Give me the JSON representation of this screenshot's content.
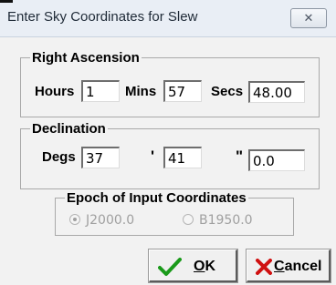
{
  "window": {
    "title": "Enter Sky Coordinates for Slew",
    "close_glyph": "✕"
  },
  "right_ascension": {
    "legend": "Right Ascension",
    "hours_label": "Hours",
    "hours_value": "1",
    "mins_label": "Mins",
    "mins_value": "57",
    "secs_label": "Secs",
    "secs_value": "48.00"
  },
  "declination": {
    "legend": "Declination",
    "degs_label": "Degs",
    "degs_value": "37",
    "min_symbol": "'",
    "min_value": "41",
    "sec_symbol": "\"",
    "sec_value": "0.0"
  },
  "epoch": {
    "legend": "Epoch of Input Coordinates",
    "options": [
      {
        "label": "J2000.0",
        "selected": true,
        "enabled": false
      },
      {
        "label": "B1950.0",
        "selected": false,
        "enabled": false
      }
    ]
  },
  "buttons": {
    "ok_u": "O",
    "ok_rest": "K",
    "ok_icon": "checkmark-icon",
    "cancel_u": "C",
    "cancel_rest": "ancel",
    "cancel_icon": "x-icon"
  },
  "colors": {
    "ok_check": "#1a9a1a",
    "cancel_x": "#d01010"
  }
}
